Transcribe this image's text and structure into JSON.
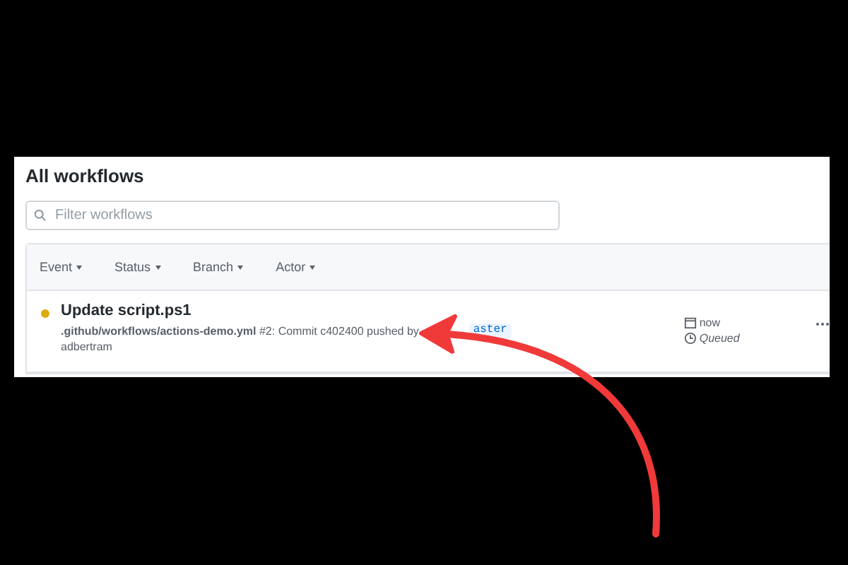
{
  "title": "All workflows",
  "search": {
    "placeholder": "Filter workflows"
  },
  "filters": [
    {
      "label": "Event"
    },
    {
      "label": "Status"
    },
    {
      "label": "Branch"
    },
    {
      "label": "Actor"
    }
  ],
  "runs": [
    {
      "title": "Update script.ps1",
      "color": "#dbab09",
      "workflow": ".github/workflows/actions-demo.yml",
      "details": "#2: Commit c402400 pushed by adbertram",
      "branch": "aster",
      "time": "now",
      "state_label": "Queued"
    }
  ]
}
